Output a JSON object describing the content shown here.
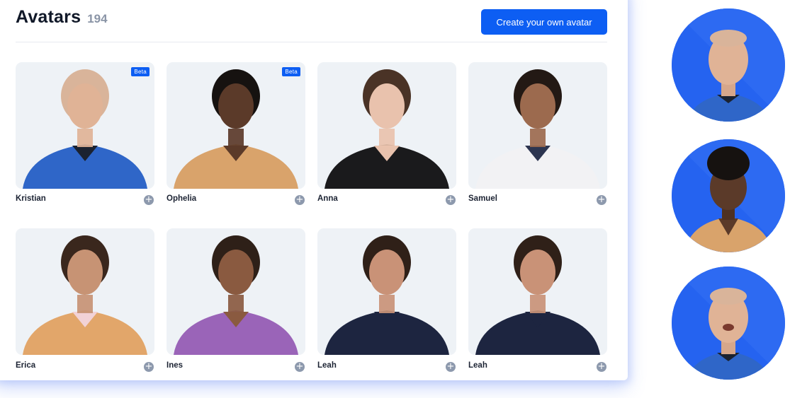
{
  "header": {
    "title": "Avatars",
    "count": "194",
    "create_button": "Create your own avatar"
  },
  "avatars": [
    {
      "name": "Kristian",
      "badge": "Beta",
      "skin": "#e0b396",
      "hair": "#d9b49a",
      "top": "#2f66c8",
      "inner": "#1b2230"
    },
    {
      "name": "Ophelia",
      "badge": "Beta",
      "skin": "#5b3a29",
      "hair": "#161210",
      "top": "#d9a36b",
      "inner": "#5b3a29"
    },
    {
      "name": "Anna",
      "badge": "",
      "skin": "#e9c2ad",
      "hair": "#4a3326",
      "top": "#1a1a1c",
      "inner": "#e9c2ad"
    },
    {
      "name": "Samuel",
      "badge": "",
      "skin": "#9c6a4e",
      "hair": "#231914",
      "top": "#f2f2f4",
      "inner": "#2c3550"
    },
    {
      "name": "Erica",
      "badge": "",
      "skin": "#c79374",
      "hair": "#3a271d",
      "top": "#e2a66a",
      "inner": "#f2d2d6"
    },
    {
      "name": "Ines",
      "badge": "",
      "skin": "#8a5a40",
      "hair": "#2e2018",
      "top": "#9a64b8",
      "inner": "#8a5a40"
    },
    {
      "name": "Leah",
      "badge": "",
      "skin": "#c99277",
      "hair": "#2f2018",
      "top": "#1d2540",
      "inner": "#1d2540"
    },
    {
      "name": "Leah",
      "badge": "",
      "skin": "#c99277",
      "hair": "#2f2018",
      "top": "#1d2540",
      "inner": "#1d2540"
    }
  ],
  "add_icon": "plus-icon",
  "colors": {
    "accent": "#0d5ef3",
    "circle_bg": "#2563f0",
    "card_bg": "#eef2f6",
    "panel_glow": "#466ef0"
  }
}
